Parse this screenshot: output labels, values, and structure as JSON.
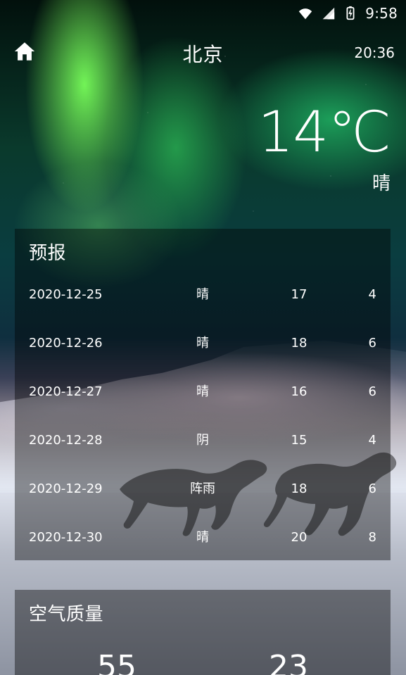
{
  "status_bar": {
    "time": "9:58",
    "icons": [
      "wifi-icon",
      "signal-icon",
      "battery-charging-icon"
    ]
  },
  "header": {
    "home_icon": "home-icon",
    "city": "北京",
    "update_time": "20:36"
  },
  "now": {
    "temperature": "14℃",
    "description": "晴"
  },
  "forecast": {
    "title": "预报",
    "items": [
      {
        "date": "2020-12-25",
        "desc": "晴",
        "max": "17",
        "min": "4"
      },
      {
        "date": "2020-12-26",
        "desc": "晴",
        "max": "18",
        "min": "6"
      },
      {
        "date": "2020-12-27",
        "desc": "晴",
        "max": "16",
        "min": "6"
      },
      {
        "date": "2020-12-28",
        "desc": "阴",
        "max": "15",
        "min": "4"
      },
      {
        "date": "2020-12-29",
        "desc": "阵雨",
        "max": "18",
        "min": "6"
      },
      {
        "date": "2020-12-30",
        "desc": "晴",
        "max": "20",
        "min": "8"
      }
    ]
  },
  "air_quality": {
    "title": "空气质量",
    "aqi": "55",
    "pm25": "23"
  },
  "colors": {
    "text": "#ffffff",
    "card_overlay": "rgba(0,0,0,0.40)"
  }
}
